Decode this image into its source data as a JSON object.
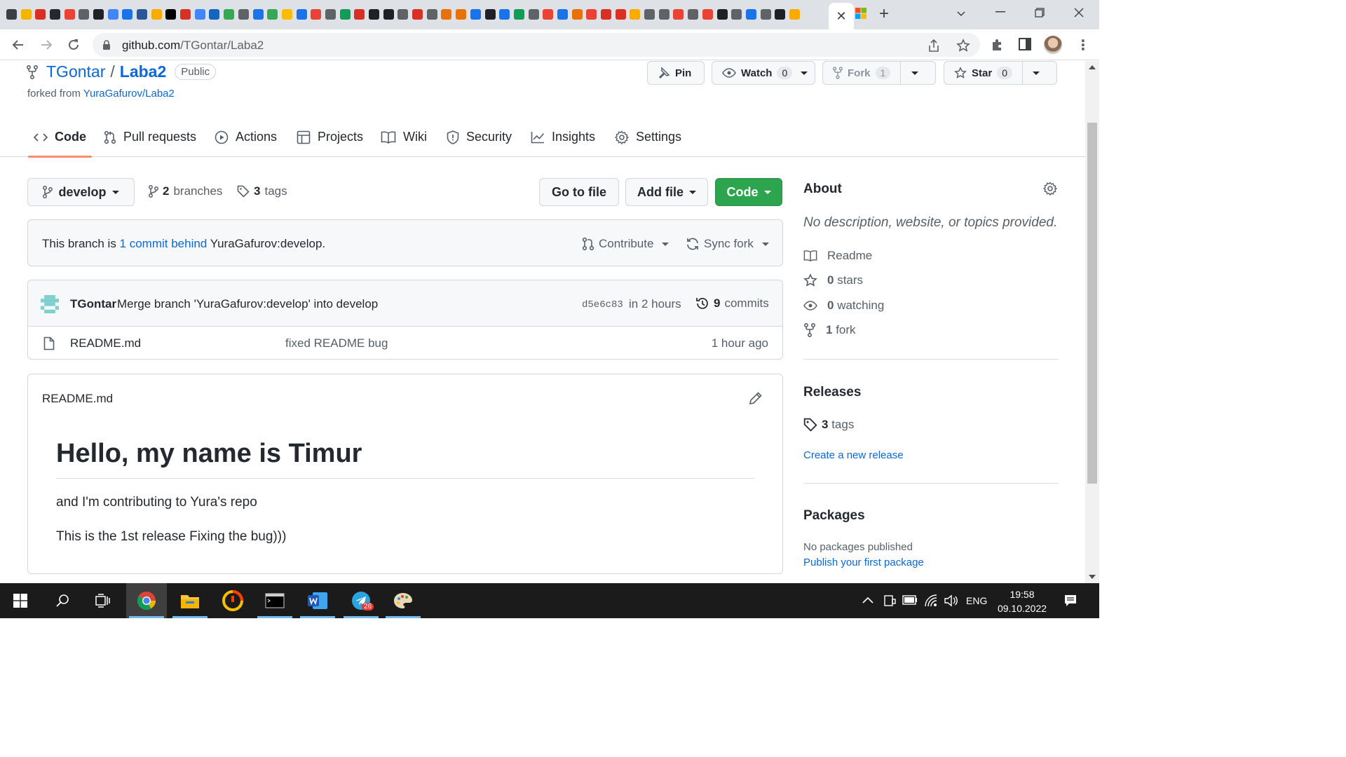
{
  "browser": {
    "favicon_colors": [
      "#3c4043",
      "#f4b400",
      "#d93025",
      "#24292f",
      "#ea4335",
      "#5f6368",
      "#202124",
      "#4285f4",
      "#1a73e8",
      "#2b579a",
      "#f9ab00",
      "#000000",
      "#d93025",
      "#4285f4",
      "#1565c0",
      "#34a853",
      "#5f6368",
      "#1a73e8",
      "#34a853",
      "#fbbc04",
      "#1a73e8",
      "#ea4335",
      "#5f6368",
      "#0f9d58",
      "#d93025",
      "#202124",
      "#202124",
      "#5f6368",
      "#d93025",
      "#5f6368",
      "#e8710a",
      "#e8710a",
      "#1a73e8",
      "#202124",
      "#1a73e8",
      "#0f9d58",
      "#5f6368",
      "#ea4335",
      "#1a73e8",
      "#e8710a",
      "#ea4335",
      "#d93025",
      "#d93025",
      "#f9ab00",
      "#5f6368",
      "#5f6368",
      "#ea4335",
      "#5f6368",
      "#ea4335",
      "#202124",
      "#5f6368",
      "#1a73e8",
      "#5f6368",
      "#202124",
      "#f9ab00"
    ],
    "active_tab_close": "✕",
    "new_tab": "+",
    "url_host": "github.com",
    "url_path": "/TGontar/Laba2"
  },
  "repo": {
    "owner": "TGontar",
    "separator": "/",
    "name": "Laba2",
    "visibility": "Public",
    "forked_prefix": "forked from ",
    "forked_from": "YuraGafurov/Laba2",
    "pin_label": "Pin",
    "watch_label": "Watch",
    "watch_count": "0",
    "fork_label": "Fork",
    "fork_count": "1",
    "star_label": "Star",
    "star_count": "0"
  },
  "tabs": [
    {
      "label": "Code",
      "icon": "code-icon"
    },
    {
      "label": "Pull requests",
      "icon": "pull-request-icon"
    },
    {
      "label": "Actions",
      "icon": "play-icon"
    },
    {
      "label": "Projects",
      "icon": "table-icon"
    },
    {
      "label": "Wiki",
      "icon": "book-icon"
    },
    {
      "label": "Security",
      "icon": "shield-icon"
    },
    {
      "label": "Insights",
      "icon": "graph-icon"
    },
    {
      "label": "Settings",
      "icon": "gear-icon"
    }
  ],
  "branchbar": {
    "branch": "develop",
    "branches_count": "2",
    "branches_label": "branches",
    "tags_count": "3",
    "tags_label": "tags",
    "go_to_file": "Go to file",
    "add_file": "Add file",
    "code": "Code"
  },
  "notice": {
    "prefix": "This branch is ",
    "link": "1 commit behind",
    "suffix": " YuraGafurov:develop.",
    "contribute": "Contribute",
    "sync": "Sync fork"
  },
  "commit": {
    "author": "TGontar",
    "message": "Merge branch 'YuraGafurov:develop' into develop",
    "sha": "d5e6c83",
    "when": "in 2 hours",
    "count": "9",
    "count_label": "commits"
  },
  "files": [
    {
      "name": "README.md",
      "message": "fixed README bug",
      "age": "1 hour ago"
    }
  ],
  "readme": {
    "title": "README.md",
    "heading": "Hello, my name is Timur",
    "p1": "and I'm contributing to Yura's repo",
    "p2": "This is the 1st release Fixing the bug)))"
  },
  "about": {
    "heading": "About",
    "description": "No description, website, or topics provided.",
    "readme": "Readme",
    "stars_count": "0",
    "stars_label": "stars",
    "watching_count": "0",
    "watching_label": "watching",
    "fork_count": "1",
    "fork_label": "fork"
  },
  "releases": {
    "heading": "Releases",
    "tags_count": "3",
    "tags_label": "tags",
    "create": "Create a new release"
  },
  "packages": {
    "heading": "Packages",
    "none": "No packages published",
    "publish": "Publish your first package"
  },
  "taskbar": {
    "telegram_badge": "26",
    "lang": "ENG",
    "time": "19:58",
    "date": "09.10.2022"
  },
  "colors": {
    "accent": "#0969da",
    "green_button": "#2da44e",
    "tab_underline": "#fd8c73"
  }
}
